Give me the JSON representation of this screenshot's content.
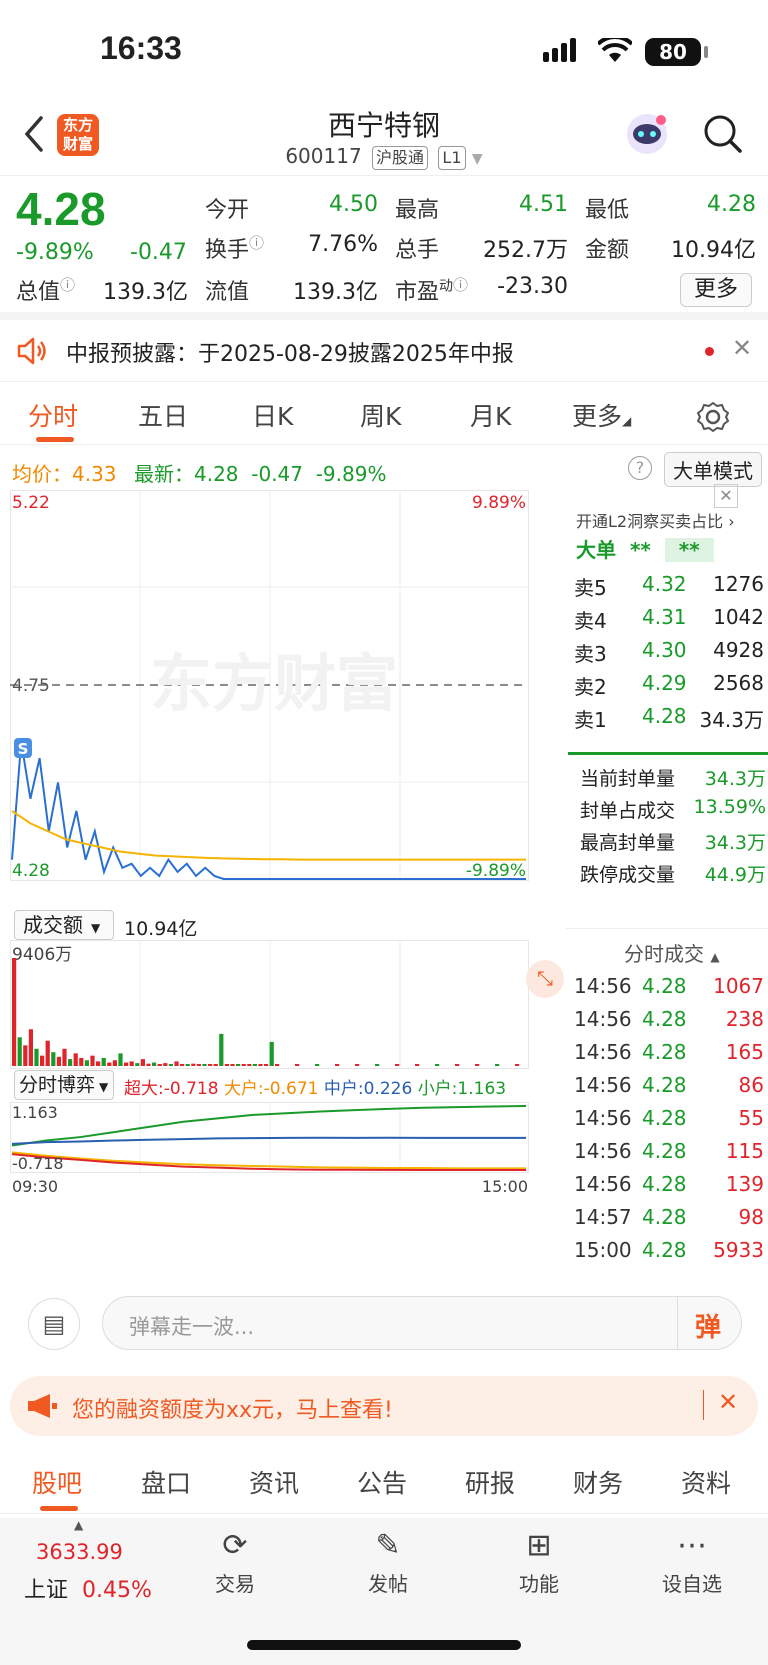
{
  "status": {
    "time": "16:33",
    "battery": "80"
  },
  "header": {
    "logo_line1": "东方",
    "logo_line2": "财富",
    "stock_name": "西宁特钢",
    "stock_code": "600117",
    "tag1": "沪股通",
    "tag2": "L1"
  },
  "quote": {
    "price": "4.28",
    "change_pct": "-9.89%",
    "change": "-0.47",
    "open_label": "今开",
    "open": "4.50",
    "high_label": "最高",
    "high": "4.51",
    "low_label": "最低",
    "low": "4.28",
    "turnover_label": "换手",
    "turnover": "7.76%",
    "volume_label": "总手",
    "volume": "252.7万",
    "amount_label": "金额",
    "amount": "10.94亿",
    "mcap_label": "总值",
    "mcap": "139.3亿",
    "float_label": "流值",
    "float": "139.3亿",
    "pe_label": "市盈",
    "pe_sup": "动",
    "pe": "-23.30",
    "more": "更多"
  },
  "notice": {
    "text": "中报预披露：于2025-08-29披露2025年中报"
  },
  "tabs": [
    "分时",
    "五日",
    "日K",
    "周K",
    "月K",
    "更多"
  ],
  "info": {
    "avg_label": "均价：",
    "avg": "4.33",
    "latest_label": "最新：",
    "latest": "4.28",
    "latest_chg": "-0.47",
    "latest_pct": "-9.89%",
    "mode_btn": "大单模式"
  },
  "chart_data": [
    {
      "type": "line",
      "axis_left_top": "5.22",
      "axis_left_mid": "4.75",
      "axis_left_bottom": "4.28",
      "axis_right_top": "9.89%",
      "axis_right_bottom": "-9.89%",
      "watermark": "东方财富",
      "marker": "S",
      "series": [
        {
          "values": [
            4.33,
            4.62,
            4.48,
            4.58,
            4.4,
            4.52,
            4.36,
            4.45,
            4.33,
            4.4,
            4.3,
            4.36,
            4.31,
            4.32,
            4.29,
            4.31,
            4.29,
            4.33,
            4.3,
            4.32,
            4.29,
            4.31,
            4.29,
            4.28,
            4.28,
            4.28,
            4.28,
            4.28,
            4.28,
            4.28
          ]
        },
        {
          "values": [
            4.45,
            4.42,
            4.4,
            4.38,
            4.37,
            4.36,
            4.35,
            4.345,
            4.34,
            4.338,
            4.336,
            4.334,
            4.333,
            4.332,
            4.331,
            4.331,
            4.33,
            4.33,
            4.33,
            4.33,
            4.33,
            4.33,
            4.33,
            4.33,
            4.33,
            4.33,
            4.33,
            4.33,
            4.33,
            4.33
          ]
        }
      ]
    },
    {
      "type": "bar",
      "selector": "成交额",
      "total": "10.94亿",
      "max_label": "9406万",
      "values": [
        9406,
        2500,
        1800,
        3200,
        1500,
        900,
        2200,
        1200,
        800,
        1500,
        600,
        1100,
        700,
        500,
        900,
        400,
        700,
        300,
        500,
        1100,
        300,
        400,
        250,
        600,
        200,
        300,
        150,
        250,
        100,
        400,
        150,
        100,
        200,
        80,
        150,
        100,
        60,
        2800,
        100,
        50,
        80,
        40,
        60,
        50,
        40,
        30,
        2100,
        20,
        30,
        20,
        20,
        20,
        20,
        20,
        20,
        20,
        20,
        20,
        20,
        20
      ]
    },
    {
      "type": "line",
      "selector": "分时博弈",
      "legend": {
        "super": "超大:-0.718",
        "large": "大户:-0.671",
        "mid": "中户:0.226",
        "small": "小户:1.163"
      },
      "ylabel_top": "1.163",
      "ylabel_bottom": "-0.718",
      "x_start": "09:30",
      "x_end": "15:00",
      "series": [
        {
          "name": "小户",
          "values": [
            0,
            0.15,
            0.25,
            0.4,
            0.55,
            0.7,
            0.8,
            0.9,
            0.95,
            1.0,
            1.04,
            1.08,
            1.11,
            1.13,
            1.15,
            1.163
          ]
        },
        {
          "name": "中户",
          "values": [
            0.05,
            0.1,
            0.12,
            0.15,
            0.17,
            0.19,
            0.21,
            0.22,
            0.225,
            0.23,
            0.226,
            0.23,
            0.225,
            0.226,
            0.226,
            0.226
          ]
        },
        {
          "name": "大户",
          "values": [
            -0.2,
            -0.3,
            -0.38,
            -0.45,
            -0.5,
            -0.55,
            -0.58,
            -0.6,
            -0.62,
            -0.64,
            -0.65,
            -0.66,
            -0.66,
            -0.67,
            -0.671,
            -0.671
          ]
        },
        {
          "name": "超大",
          "values": [
            -0.25,
            -0.35,
            -0.42,
            -0.5,
            -0.56,
            -0.62,
            -0.65,
            -0.68,
            -0.7,
            -0.71,
            -0.71,
            -0.715,
            -0.718,
            -0.718,
            -0.718,
            -0.718
          ]
        }
      ]
    }
  ],
  "side": {
    "l2_text": "开通L2洞察买卖占比",
    "big_label": "大单",
    "big_val1": "**",
    "big_val2": "**",
    "asks": [
      {
        "label": "卖5",
        "price": "4.32",
        "vol": "1276"
      },
      {
        "label": "卖4",
        "price": "4.31",
        "vol": "1042"
      },
      {
        "label": "卖3",
        "price": "4.30",
        "vol": "4928"
      },
      {
        "label": "卖2",
        "price": "4.29",
        "vol": "2568"
      },
      {
        "label": "卖1",
        "price": "4.28",
        "vol": "34.3万"
      }
    ],
    "stats": [
      {
        "label": "当前封单量",
        "value": "34.3万"
      },
      {
        "label": "封单占成交",
        "value": "13.59%"
      },
      {
        "label": "最高封单量",
        "value": "34.3万"
      },
      {
        "label": "跌停成交量",
        "value": "44.9万"
      }
    ],
    "trades_title": "分时成交",
    "trades": [
      {
        "time": "14:56",
        "price": "4.28",
        "vol": "1067"
      },
      {
        "time": "14:56",
        "price": "4.28",
        "vol": "238"
      },
      {
        "time": "14:56",
        "price": "4.28",
        "vol": "165"
      },
      {
        "time": "14:56",
        "price": "4.28",
        "vol": "86"
      },
      {
        "time": "14:56",
        "price": "4.28",
        "vol": "55"
      },
      {
        "time": "14:56",
        "price": "4.28",
        "vol": "115"
      },
      {
        "time": "14:56",
        "price": "4.28",
        "vol": "139"
      },
      {
        "time": "14:57",
        "price": "4.28",
        "vol": "98"
      },
      {
        "time": "15:00",
        "price": "4.28",
        "vol": "5933"
      }
    ]
  },
  "comment": {
    "placeholder": "弹幕走一波...",
    "danmu": "弹"
  },
  "banner": {
    "text": "您的融资额度为xx元，马上查看!"
  },
  "subtabs": [
    "股吧",
    "盘口",
    "资讯",
    "公告",
    "研报",
    "财务",
    "资料"
  ],
  "footer": {
    "index_value": "3633.99",
    "index_name": "上证",
    "index_pct": "0.45%",
    "trade": "交易",
    "post": "发帖",
    "func": "功能",
    "watch": "设自选"
  }
}
